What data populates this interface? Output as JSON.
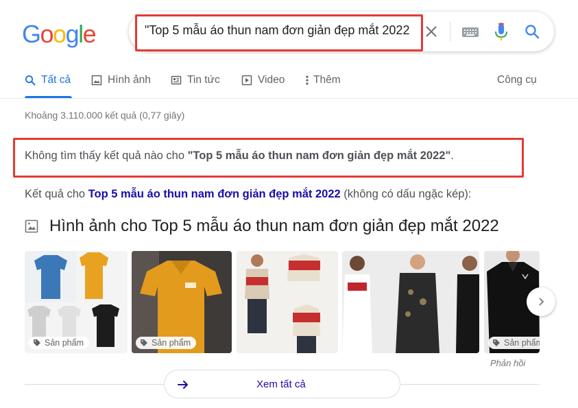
{
  "logo": {
    "letters": [
      "G",
      "o",
      "o",
      "g",
      "l",
      "e"
    ],
    "colors": [
      "#4285f4",
      "#ea4335",
      "#fbbc05",
      "#4285f4",
      "#34a853",
      "#ea4335"
    ]
  },
  "search": {
    "query": "\"Top 5 mẫu áo thun nam đơn giản đẹp mắt 2022"
  },
  "tabs": {
    "all": "Tất cả",
    "images": "Hình ảnh",
    "news": "Tin tức",
    "video": "Video",
    "more": "Thêm",
    "tools": "Công cụ"
  },
  "stats": "Khoảng 3.110.000 kết quả (0,77 giây)",
  "notfound": {
    "prefix": "Không tìm thấy kết quả nào cho ",
    "query": "\"Top 5 mẫu áo thun nam đơn giản đẹp mắt 2022\"",
    "suffix": "."
  },
  "showing": {
    "prefix": "Kết quả cho ",
    "link": "Top 5 mẫu áo thun nam đơn giản đẹp mắt 2022",
    "suffix": " (không có dấu ngặc kép):"
  },
  "images_heading": "Hình ảnh cho Top 5 mẫu áo thun nam đơn giản đẹp mắt 2022",
  "product_chip": "Sản phẩm",
  "feedback": "Phản hồi",
  "view_all": "Xem tất cả",
  "accent_color": "#1a73e8",
  "highlight_color": "#e53935"
}
